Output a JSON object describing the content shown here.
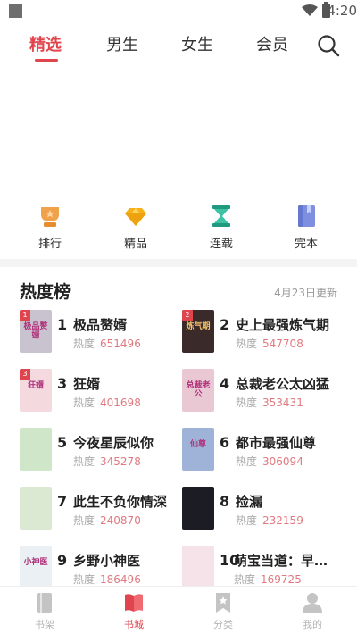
{
  "status_bar": {
    "time": "4:20"
  },
  "top_tabs": [
    {
      "label": "精选",
      "active": true
    },
    {
      "label": "男生",
      "active": false
    },
    {
      "label": "女生",
      "active": false
    },
    {
      "label": "会员",
      "active": false
    }
  ],
  "shortcuts": [
    {
      "label": "排行",
      "icon": "trophy-icon"
    },
    {
      "label": "精品",
      "icon": "diamond-icon"
    },
    {
      "label": "连载",
      "icon": "hourglass-icon"
    },
    {
      "label": "完本",
      "icon": "book-icon"
    }
  ],
  "ranking": {
    "title": "热度榜",
    "update_date": "4月23日更新",
    "heat_label": "热度",
    "books": [
      {
        "rank": "1",
        "badge": "1",
        "title": "极品赘婿",
        "heat": "651496",
        "cover_text": "极品赘婿",
        "cover_color": "#c9c2cf"
      },
      {
        "rank": "2",
        "badge": "2",
        "title": "史上最强炼气期",
        "heat": "547708",
        "cover_text": "炼气期",
        "cover_color": "#3a2a2a"
      },
      {
        "rank": "3",
        "badge": "3",
        "title": "狂婿",
        "heat": "401698",
        "cover_text": "狂婿",
        "cover_color": "#f4d9df"
      },
      {
        "rank": "4",
        "badge": "",
        "title": "总裁老公太凶猛",
        "heat": "353431",
        "cover_text": "总裁老公",
        "cover_color": "#e9c7d3"
      },
      {
        "rank": "5",
        "badge": "",
        "title": "今夜星辰似你",
        "heat": "345278",
        "cover_text": "",
        "cover_color": "#cfe6c9"
      },
      {
        "rank": "6",
        "badge": "",
        "title": "都市最强仙尊",
        "heat": "306094",
        "cover_text": "仙尊",
        "cover_color": "#9fb3d8"
      },
      {
        "rank": "7",
        "badge": "",
        "title": "此生不负你情深",
        "heat": "240870",
        "cover_text": "",
        "cover_color": "#dbe9d2"
      },
      {
        "rank": "8",
        "badge": "",
        "title": "捡漏",
        "heat": "232159",
        "cover_text": "",
        "cover_color": "#1c1c24"
      },
      {
        "rank": "9",
        "badge": "",
        "title": "乡野小神医",
        "heat": "186496",
        "cover_text": "小神医",
        "cover_color": "#eaf0f4"
      },
      {
        "rank": "10",
        "badge": "",
        "title": "萌宝当道：早安…",
        "heat": "169725",
        "cover_text": "",
        "cover_color": "#f6e3ea"
      }
    ]
  },
  "bottom_nav": [
    {
      "label": "书架",
      "active": false
    },
    {
      "label": "书城",
      "active": true
    },
    {
      "label": "分类",
      "active": false
    },
    {
      "label": "我的",
      "active": false
    }
  ],
  "colors": {
    "accent": "#e0454d",
    "heat_number": "#e07a80",
    "muted": "#999999"
  }
}
